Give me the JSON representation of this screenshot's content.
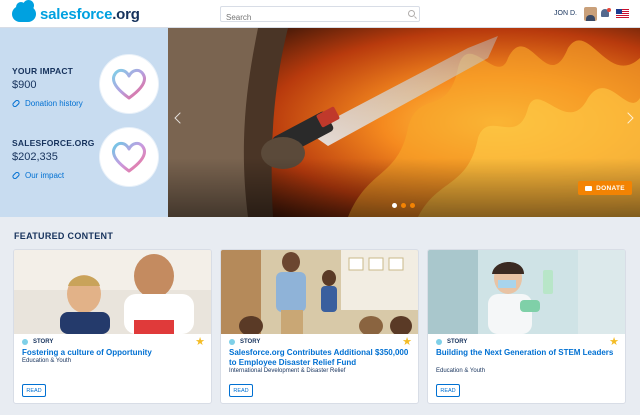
{
  "header": {
    "logo_text": "salesforce",
    "logo_suffix": ".org",
    "search_placeholder": "Search",
    "user_name": "JON D.",
    "icons": [
      "search-icon",
      "avatar",
      "bell-icon",
      "us-flag-icon"
    ]
  },
  "impact": {
    "your_title": "YOUR IMPACT",
    "your_value": "$900",
    "your_link": "Donation history",
    "org_title": "SALESFORCE.ORG",
    "org_value": "$202,335",
    "org_link": "Our impact"
  },
  "hero": {
    "donate_label": "DONATE",
    "slide_count": 3,
    "active_slide": 1
  },
  "featured": {
    "title": "FEATURED CONTENT",
    "cards": [
      {
        "type": "STORY",
        "title": "Fostering a culture of Opportunity",
        "subtitle": "Education & Youth",
        "button": "READ"
      },
      {
        "type": "STORY",
        "title": "Salesforce.org Contributes Additional $350,000 to Employee Disaster Relief Fund",
        "subtitle": "International Development & Disaster Relief",
        "button": "READ"
      },
      {
        "type": "STORY",
        "title": "Building the Next Generation of STEM Leaders",
        "subtitle": "Education & Youth",
        "button": "READ"
      }
    ]
  },
  "colors": {
    "brand": "#00a1e0",
    "link": "#0070d2",
    "donate": "#f38303",
    "star": "#f4bc25"
  }
}
